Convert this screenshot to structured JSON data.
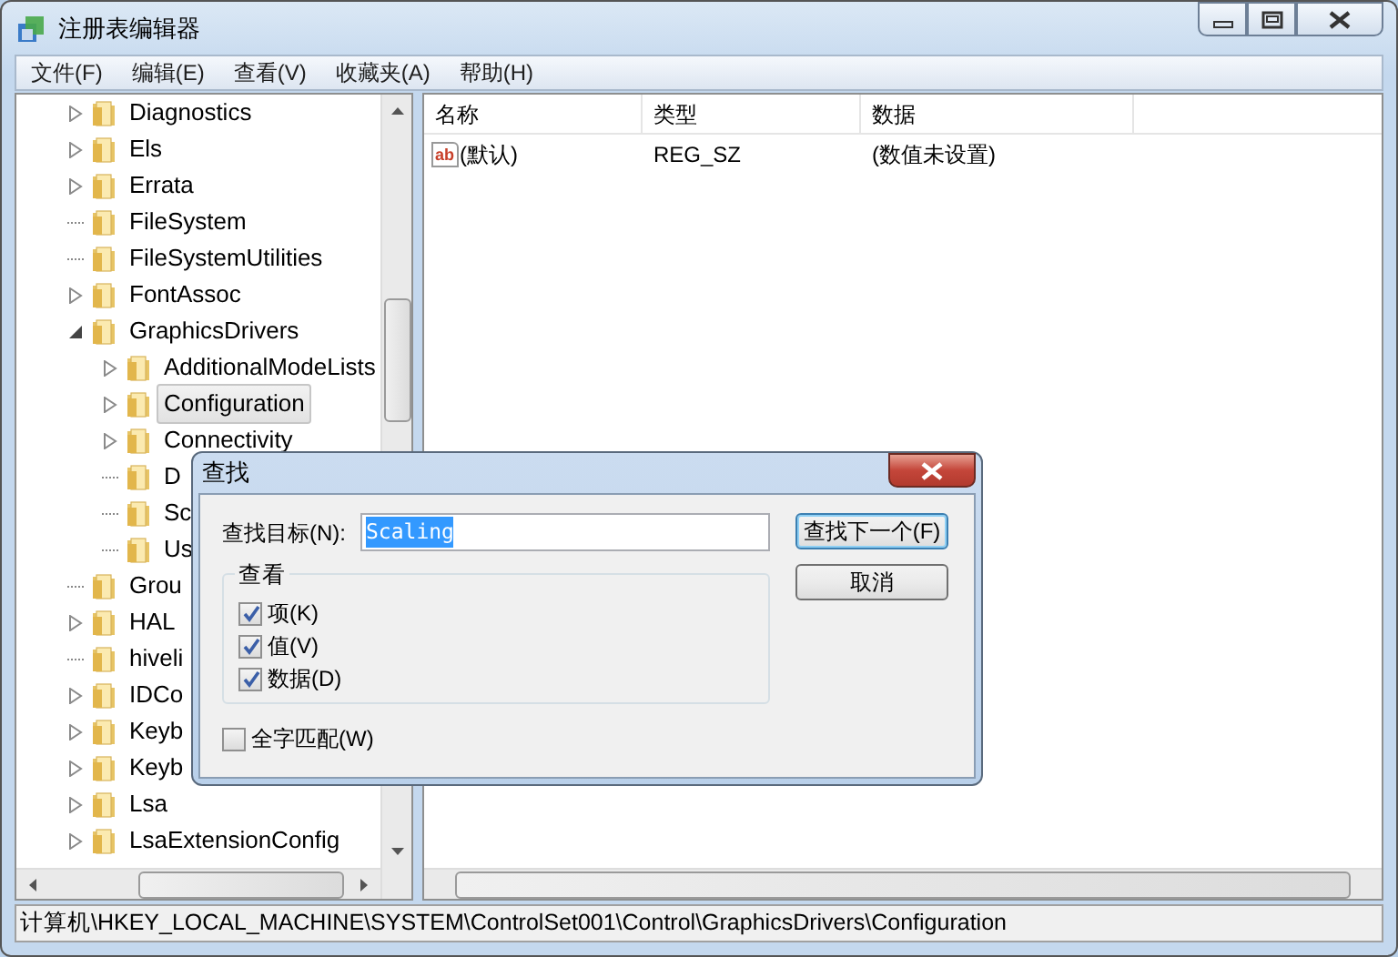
{
  "window": {
    "title": "注册表编辑器"
  },
  "menu": [
    {
      "label": "文件(F)"
    },
    {
      "label": "编辑(E)"
    },
    {
      "label": "查看(V)"
    },
    {
      "label": "收藏夹(A)"
    },
    {
      "label": "帮助(H)"
    }
  ],
  "tree": [
    {
      "label": "Diagnostics",
      "kind": "collapsed",
      "selected": false
    },
    {
      "label": "Els",
      "kind": "collapsed",
      "selected": false
    },
    {
      "label": "Errata",
      "kind": "collapsed",
      "selected": false
    },
    {
      "label": "FileSystem",
      "kind": "leaf",
      "selected": false
    },
    {
      "label": "FileSystemUtilities",
      "kind": "leaf",
      "selected": false
    },
    {
      "label": "FontAssoc",
      "kind": "collapsed",
      "selected": false
    },
    {
      "label": "GraphicsDrivers",
      "kind": "expanded",
      "selected": false,
      "children": [
        {
          "label": "AdditionalModeLists",
          "kind": "collapsed",
          "selected": false
        },
        {
          "label": "Configuration",
          "kind": "collapsed",
          "selected": true
        },
        {
          "label": "Connectivity",
          "kind": "collapsed",
          "selected": false
        },
        {
          "label": "D",
          "kind": "leaf",
          "selected": false
        },
        {
          "label": "Sc",
          "kind": "leaf",
          "selected": false
        },
        {
          "label": "Us",
          "kind": "leaf",
          "selected": false
        }
      ]
    },
    {
      "label": "Grou",
      "kind": "leaf",
      "selected": false
    },
    {
      "label": "HAL",
      "kind": "collapsed",
      "selected": false
    },
    {
      "label": "hiveli",
      "kind": "leaf",
      "selected": false
    },
    {
      "label": "IDCo",
      "kind": "collapsed",
      "selected": false
    },
    {
      "label": "Keyb",
      "kind": "collapsed",
      "selected": false
    },
    {
      "label": "Keyb",
      "kind": "collapsed",
      "selected": false
    },
    {
      "label": "Lsa",
      "kind": "collapsed",
      "selected": false
    },
    {
      "label": "LsaExtensionConfig",
      "kind": "collapsed",
      "selected": false
    }
  ],
  "list": {
    "columns": [
      "名称",
      "类型",
      "数据"
    ],
    "rows": [
      {
        "icon_text": "ab",
        "name": "(默认)",
        "type": "REG_SZ",
        "data": "(数值未设置)"
      }
    ]
  },
  "status_bar": "计算机\\HKEY_LOCAL_MACHINE\\SYSTEM\\ControlSet001\\Control\\GraphicsDrivers\\Configuration",
  "dialog": {
    "title": "查找",
    "find_label": "查找目标(N):",
    "find_value": "Scaling",
    "buttons": [
      {
        "label": "查找下一个(F)",
        "default": true
      },
      {
        "label": "取消",
        "default": false
      }
    ],
    "group_title": "查看",
    "options": [
      {
        "label": "项(K)",
        "checked": true
      },
      {
        "label": "值(V)",
        "checked": true
      },
      {
        "label": "数据(D)",
        "checked": true
      }
    ],
    "match_whole": {
      "label": "全字匹配(W)",
      "checked": false
    }
  }
}
